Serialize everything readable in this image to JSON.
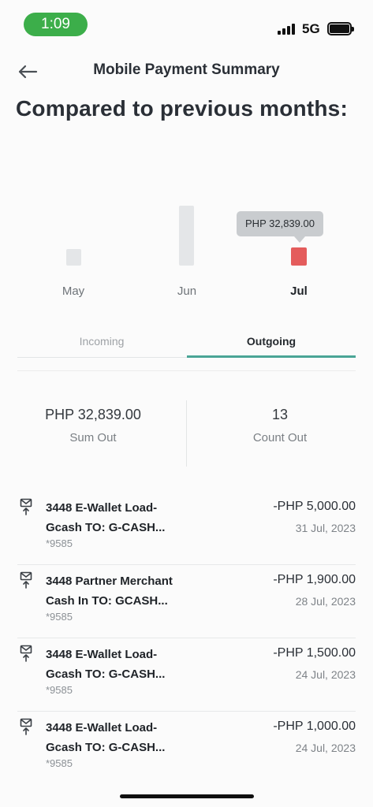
{
  "status_bar": {
    "time": "1:09",
    "network": "5G"
  },
  "header": {
    "title": "Mobile Payment Summary"
  },
  "headline": "Compared to previous months:",
  "chart_data": {
    "type": "bar",
    "categories": [
      "May",
      "Jun",
      "Jul"
    ],
    "values": [
      null,
      null,
      32839.0
    ],
    "selected": "Jul",
    "tooltip": "PHP 32,839.00",
    "colors": {
      "default": "#e4e6e8",
      "selected": "#e45c5c"
    }
  },
  "tabs": [
    {
      "label": "Incoming",
      "active": false
    },
    {
      "label": "Outgoing",
      "active": true
    }
  ],
  "summary": {
    "sum_value": "PHP 32,839.00",
    "sum_label": "Sum Out",
    "count_value": "13",
    "count_label": "Count Out"
  },
  "transactions": [
    {
      "title_line1": "3448 E-Wallet Load-",
      "title_line2": "Gcash TO: G-CASH...",
      "account": "*9585",
      "amount": "-PHP 5,000.00",
      "date": "31 Jul, 2023"
    },
    {
      "title_line1": "3448 Partner Merchant",
      "title_line2": "Cash In TO: GCASH...",
      "account": "*9585",
      "amount": "-PHP 1,900.00",
      "date": "28 Jul, 2023"
    },
    {
      "title_line1": "3448 E-Wallet Load-",
      "title_line2": "Gcash TO: G-CASH...",
      "account": "*9585",
      "amount": "-PHP 1,500.00",
      "date": "24 Jul, 2023"
    },
    {
      "title_line1": "3448 E-Wallet Load-",
      "title_line2": "Gcash TO: G-CASH...",
      "account": "*9585",
      "amount": "-PHP 1,000.00",
      "date": "24 Jul, 2023"
    }
  ],
  "icons": {
    "back": "arrow-left-icon",
    "transaction": "outgoing-transfer-icon",
    "signal": "signal-icon",
    "battery": "battery-icon"
  },
  "colors": {
    "accent": "#4aa596",
    "status_pill": "#3cae4a",
    "highlight_bar": "#e45c5c"
  }
}
